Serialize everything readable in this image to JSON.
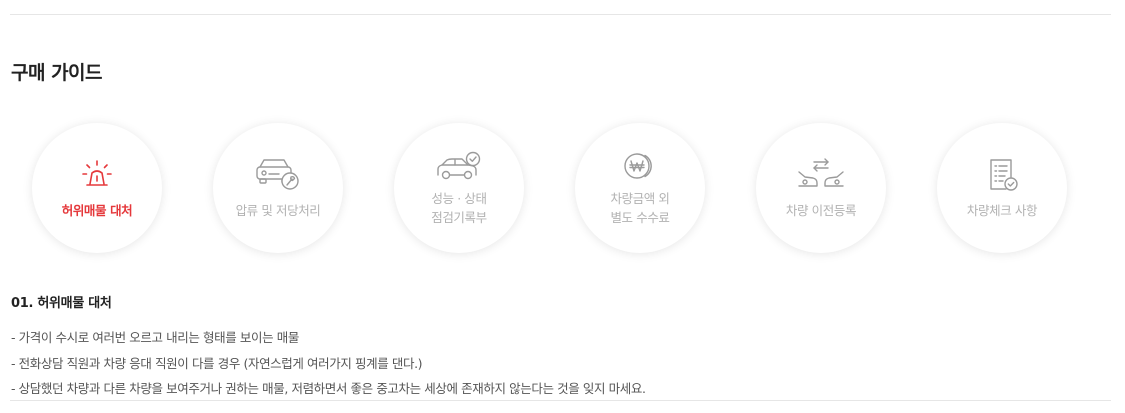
{
  "section_title": "구매 가이드",
  "guide_items": [
    {
      "label_lines": [
        "허위매물 대처"
      ],
      "icon": "siren-icon",
      "active": true
    },
    {
      "label_lines": [
        "압류 및 저당처리"
      ],
      "icon": "car-wrench-icon",
      "active": false
    },
    {
      "label_lines": [
        "성능 · 상태",
        "점검기록부"
      ],
      "icon": "car-check-icon",
      "active": false
    },
    {
      "label_lines": [
        "차량금액 외",
        "별도 수수료"
      ],
      "icon": "won-coin-icon",
      "active": false
    },
    {
      "label_lines": [
        "차량 이전등록"
      ],
      "icon": "car-transfer-icon",
      "active": false
    },
    {
      "label_lines": [
        "차량체크 사항"
      ],
      "icon": "checklist-icon",
      "active": false
    }
  ],
  "detail": {
    "title": "01. 허위매물 대처",
    "lines": [
      "- 가격이 수시로 여러번 오르고 내리는 형태를 보이는 매물",
      "- 전화상담 직원과 차량 응대 직원이 다를 경우 (자연스럽게 여러가지 핑계를 댄다.)",
      "- 상담했던 차량과 다른 차량을 보여주거나 권하는 매물, 저렴하면서 좋은 중고차는 세상에 존재하지 않는다는 것을 잊지 마세요."
    ]
  },
  "colors": {
    "accent": "#e5383b",
    "inactive": "#b2b2b2",
    "icon_inactive": "#9a9a9a"
  }
}
